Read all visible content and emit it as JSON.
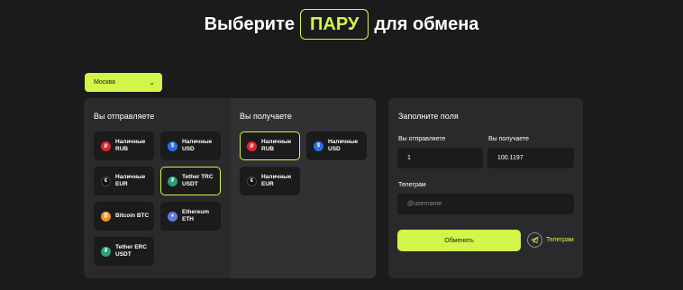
{
  "header": {
    "title_before": "Выберите",
    "title_highlight": "ПАРУ",
    "title_after": "для обмена"
  },
  "city_select": {
    "value": "Москва"
  },
  "send": {
    "title": "Вы отправляете",
    "items": [
      {
        "label": "Наличные\nRUB",
        "icon": "ruble-icon",
        "glyph": "₽",
        "color": "#e8232a",
        "selected": false
      },
      {
        "label": "Наличные\nUSD",
        "icon": "dollar-icon",
        "glyph": "$",
        "color": "#2a6ee8",
        "selected": false
      },
      {
        "label": "Наличные\nEUR",
        "icon": "euro-icon",
        "glyph": "€",
        "color": "#111111",
        "selected": false
      },
      {
        "label": "Tether TRC\nUSDT",
        "icon": "tether-icon",
        "glyph": "₮",
        "color": "#26a17b",
        "selected": true
      },
      {
        "label": "Bitcoin BTC",
        "icon": "bitcoin-icon",
        "glyph": "₿",
        "color": "#f7931a",
        "selected": false
      },
      {
        "label": "Ethereum\nETH",
        "icon": "ethereum-icon",
        "glyph": "♦",
        "color": "#5f7ce6",
        "selected": false
      },
      {
        "label": "Tether ERC\nUSDT",
        "icon": "tether-icon",
        "glyph": "₮",
        "color": "#26a17b",
        "selected": false
      }
    ]
  },
  "receive": {
    "title": "Вы получаете",
    "items": [
      {
        "label": "Наличные\nRUB",
        "icon": "ruble-icon",
        "glyph": "₽",
        "color": "#e8232a",
        "selected": true
      },
      {
        "label": "Наличные\nUSD",
        "icon": "dollar-icon",
        "glyph": "$",
        "color": "#2a6ee8",
        "selected": false
      },
      {
        "label": "Наличные\nEUR",
        "icon": "euro-icon",
        "glyph": "€",
        "color": "#111111",
        "selected": false
      }
    ]
  },
  "form": {
    "title": "Заполните поля",
    "send_label": "Вы отправляете",
    "send_value": "1",
    "receive_label": "Вы получаете",
    "receive_value": "100.1197",
    "telegram_label": "Телеграм",
    "telegram_placeholder": "@username",
    "submit_label": "Обменять",
    "telegram_link": "Телеграм"
  },
  "colors": {
    "accent": "#d2f54a",
    "background": "#1b1b1c",
    "panel": "#2a2a2d"
  }
}
